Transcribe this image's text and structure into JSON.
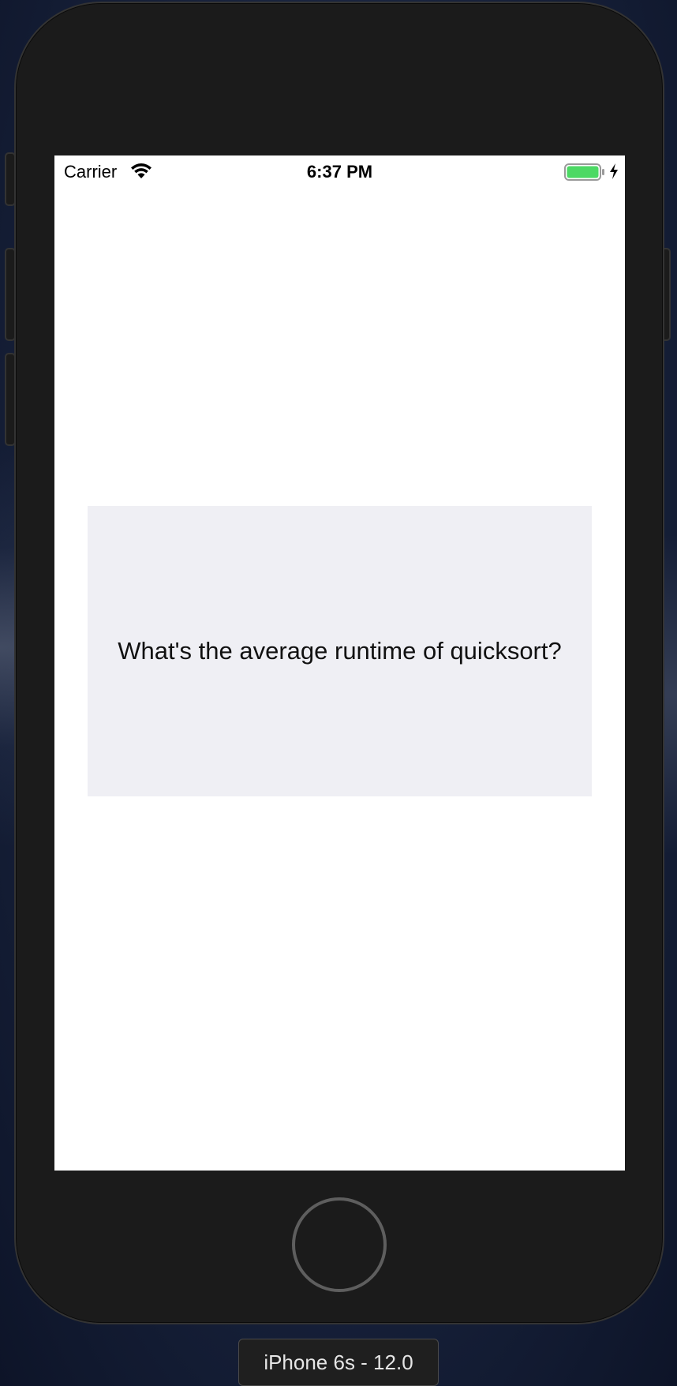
{
  "status_bar": {
    "carrier": "Carrier",
    "time": "6:37 PM",
    "battery_color": "#4cd964"
  },
  "card": {
    "question": "What's the average runtime of quicksort?",
    "background": "#efeff4"
  },
  "simulator": {
    "device_label": "iPhone 6s - 12.0"
  },
  "icons": {
    "wifi": "wifi-icon",
    "battery": "battery-icon",
    "charging": "charging-bolt-icon",
    "home": "home-button"
  }
}
